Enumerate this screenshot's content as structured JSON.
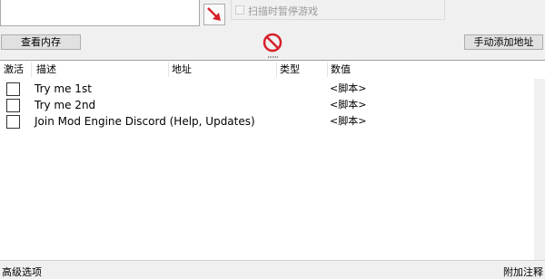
{
  "toolbar": {
    "scan_pause_label": "扫描时暂停游戏",
    "view_memory_label": "查看内存",
    "add_address_label": "手动添加地址"
  },
  "table": {
    "headers": {
      "active": "激活",
      "description": "描述",
      "address": "地址",
      "type": "类型",
      "value": "数值"
    },
    "rows": [
      {
        "description": "Try me 1st",
        "value": "<脚本>"
      },
      {
        "description": "Try me 2nd",
        "value": "<脚本>"
      },
      {
        "description": "Join Mod Engine Discord (Help, Updates)",
        "value": "<脚本>"
      }
    ]
  },
  "status": {
    "advanced_options": "高级选项",
    "add_comment": "附加注释"
  },
  "colors": {
    "arrow": "#d6202a",
    "stop": "#d6202a"
  }
}
